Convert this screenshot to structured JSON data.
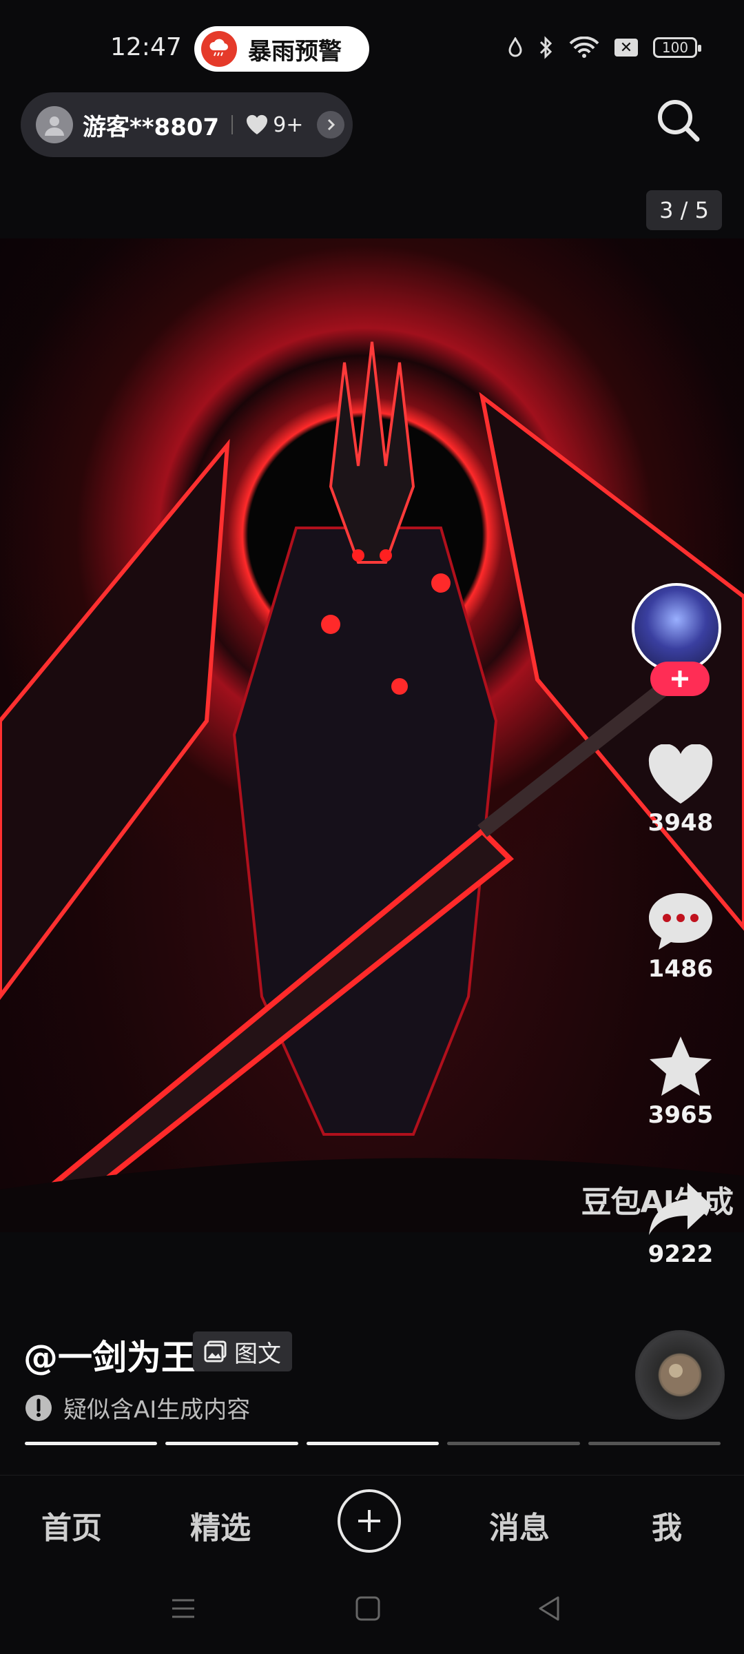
{
  "status_bar": {
    "time": "12:47",
    "alert_label": "暴雨预警",
    "battery": "100"
  },
  "header": {
    "username": "游客**8807",
    "likes_badge": "9+",
    "page_counter": "3 / 5"
  },
  "image": {
    "watermark": "豆包AI生成"
  },
  "actions": {
    "like_count": "3948",
    "comment_count": "1486",
    "favorite_count": "3965",
    "share_count": "9222"
  },
  "post": {
    "author": "@一剑为王",
    "tag": "图文",
    "ai_notice": "疑似含AI生成内容",
    "progress": {
      "total": 5,
      "current": 3
    }
  },
  "nav": {
    "home": "首页",
    "featured": "精选",
    "messages": "消息",
    "me": "我"
  },
  "colors": {
    "accent": "#ff2d55",
    "alert": "#e53a2a",
    "background": "#0a0a0c"
  }
}
